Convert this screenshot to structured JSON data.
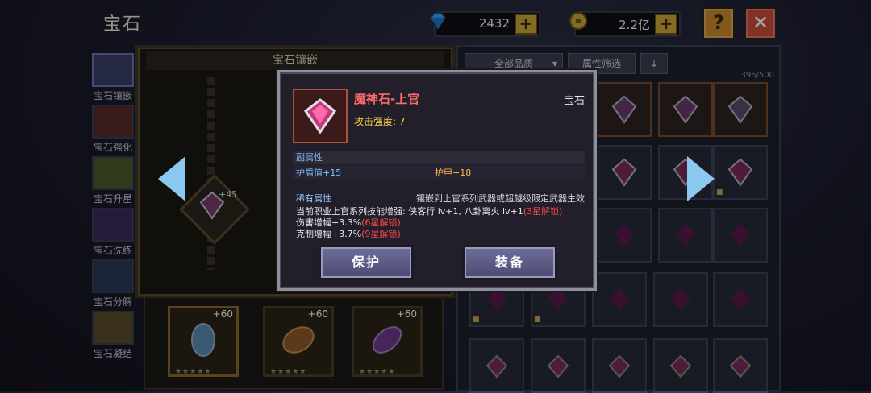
{
  "header": {
    "title": "宝石",
    "diamonds": "2432",
    "gold": "2.2亿",
    "help_label": "?",
    "close_label": "✕"
  },
  "nav": {
    "items": [
      {
        "label": "宝石镶嵌",
        "icon": "gem-inlay-icon"
      },
      {
        "label": "宝石强化",
        "icon": "gem-enhance-icon"
      },
      {
        "label": "宝石升星",
        "icon": "gem-star-icon"
      },
      {
        "label": "宝石洗练",
        "icon": "gem-refine-icon"
      },
      {
        "label": "宝石分解",
        "icon": "gem-decompose-icon"
      },
      {
        "label": "宝石凝结",
        "icon": "gem-condense-icon"
      }
    ]
  },
  "inlay_panel": {
    "title": "宝石镶嵌",
    "center_level": "+45",
    "slots": [
      {
        "level": "+60",
        "stars": "★★★★★"
      },
      {
        "level": "+60",
        "stars": "★★★★★"
      },
      {
        "level": "+60",
        "stars": "★★★★★"
      }
    ]
  },
  "inventory": {
    "filter_quality": "全部品质",
    "filter_attr": "属性筛选",
    "sort_icon": "down-arrow-icon",
    "capacity": "396/500"
  },
  "popup": {
    "name": "魔神石-上官",
    "type": "宝石",
    "attack": "攻击强度: 7",
    "sub_title": "副属性",
    "sub_attr_1": "护盾值+15",
    "sub_attr_2": "护甲+18",
    "rare_title": "稀有属性",
    "rare_note": "镶嵌到上官系列武器或超越级限定武器生效",
    "rare_line_1": "当前职业上官系列技能增强: 侠客行 lv+1, 八卦离火 lv+1",
    "rare_line_1_lock": "(3星解锁)",
    "rare_line_2": "伤害增幅+3.3%",
    "rare_line_2_lock": "(6星解锁)",
    "rare_line_3": "克制增幅+3.7%",
    "rare_line_3_lock": "(9星解锁)",
    "protect_label": "保护",
    "equip_label": "装备"
  },
  "colors": {
    "accent_gold": "#c9a43a",
    "rare_red": "#ff4a4a",
    "attr_blue": "#7fc4ff"
  }
}
